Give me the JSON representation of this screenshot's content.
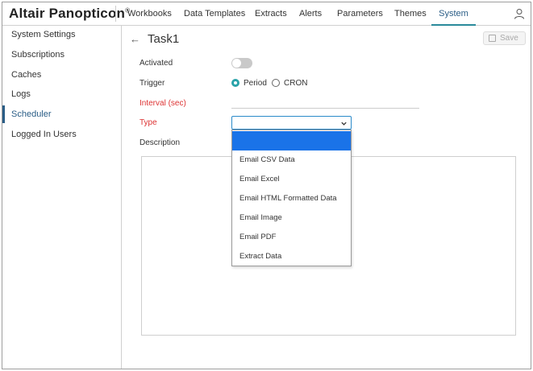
{
  "app": {
    "title": "Altair Panopticon",
    "trademark": "®"
  },
  "nav": {
    "items": [
      {
        "label": "Workbooks"
      },
      {
        "label": "Data Templates"
      },
      {
        "label": "Extracts"
      },
      {
        "label": "Alerts"
      },
      {
        "label": "Parameters"
      },
      {
        "label": "Themes"
      },
      {
        "label": "System",
        "active": true
      }
    ]
  },
  "sidebar": {
    "items": [
      {
        "label": "System Settings"
      },
      {
        "label": "Subscriptions"
      },
      {
        "label": "Caches"
      },
      {
        "label": "Logs"
      },
      {
        "label": "Scheduler",
        "active": true
      },
      {
        "label": "Logged In Users"
      }
    ]
  },
  "task": {
    "title": "Task1",
    "save_label": "Save"
  },
  "form": {
    "activated_label": "Activated",
    "activated": false,
    "trigger_label": "Trigger",
    "trigger_options": [
      {
        "label": "Period",
        "selected": true
      },
      {
        "label": "CRON",
        "selected": false
      }
    ],
    "interval_label": "Interval (sec)",
    "interval_value": "",
    "type_label": "Type",
    "type_value": "",
    "description_label": "Description",
    "description_value": ""
  },
  "type_dropdown": {
    "options": [
      "",
      "Email CSV Data",
      "Email Excel",
      "Email HTML Formatted Data",
      "Email Image",
      "Email PDF",
      "Extract Data"
    ],
    "highlighted_index": 0
  },
  "colors": {
    "accent": "#2a5d86",
    "radio_on": "#2aa3a9",
    "required": "#dd3333",
    "dropdown_highlight": "#1a73e8"
  }
}
